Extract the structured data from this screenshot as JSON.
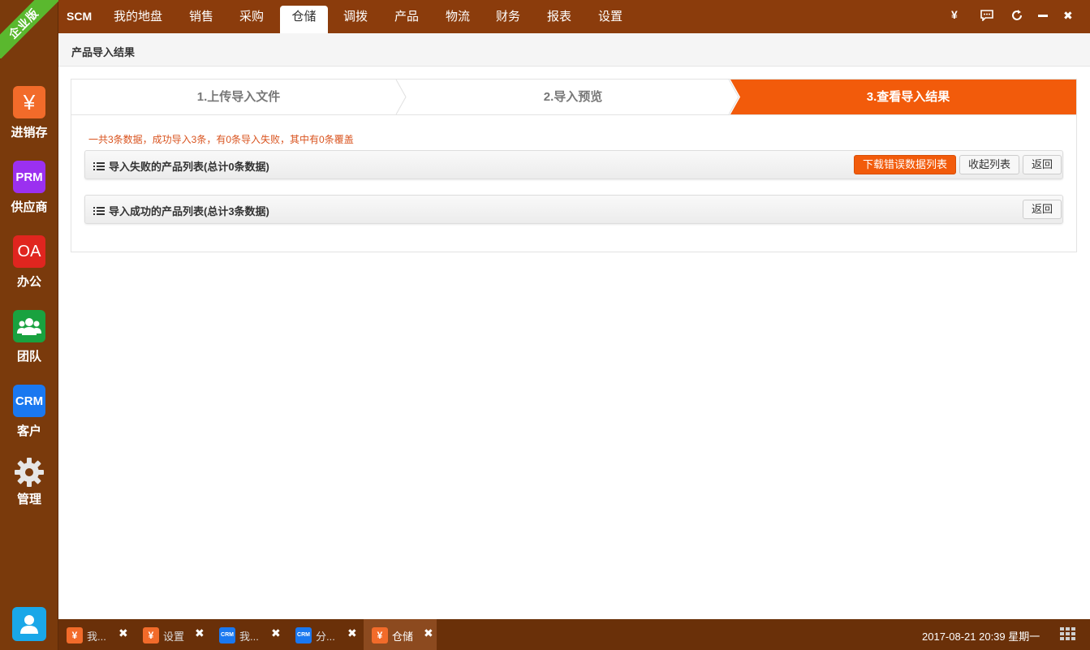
{
  "edition_badge": "企业版",
  "sidebar": {
    "items": [
      {
        "icon_text": "¥",
        "label": "进销存",
        "color": "#f26b2a"
      },
      {
        "icon_text": "PRM",
        "label": "供应商",
        "color": "#9b30f0"
      },
      {
        "icon_text": "OA",
        "label": "办公",
        "color": "#e0251f"
      },
      {
        "icon_text": "",
        "label": "团队",
        "color": "#19a23f"
      },
      {
        "icon_text": "CRM",
        "label": "客户",
        "color": "#1a78f0"
      },
      {
        "icon_text": "",
        "label": "管理",
        "color": "#dddddd"
      }
    ],
    "user_icon_color": "#1aa7e8"
  },
  "topbar": {
    "brand": "SCM",
    "tabs": [
      "我的地盘",
      "销售",
      "采购",
      "仓储",
      "调拨",
      "产品",
      "物流",
      "财务",
      "报表",
      "设置"
    ],
    "active_tab": "仓储",
    "controls": {
      "yen": "¥",
      "chat": "💬",
      "refresh": "↻",
      "minimize": "—",
      "close": "✖"
    }
  },
  "breadcrumb": {
    "title": "产品导入结果"
  },
  "steps": [
    {
      "label": "1.上传导入文件"
    },
    {
      "label": "2.导入预览"
    },
    {
      "label": "3.查看导入结果"
    }
  ],
  "summary": "一共3条数据，成功导入3条，有0条导入失败，其中有0条覆盖",
  "failed_panel": {
    "title": "导入失败的产品列表(总计0条数据)",
    "download_label": "下载错误数据列表",
    "collapse_label": "收起列表",
    "back_label": "返回"
  },
  "success_panel": {
    "title": "导入成功的产品列表(总计3条数据)",
    "back_label": "返回"
  },
  "taskbar": {
    "tasks": [
      {
        "icon_text": "¥",
        "label": "我...",
        "color": "#f26b2a"
      },
      {
        "icon_text": "¥",
        "label": "设置",
        "color": "#f26b2a"
      },
      {
        "icon_text": "CRM",
        "label": "我...",
        "color": "#1a78f0"
      },
      {
        "icon_text": "CRM",
        "label": "分...",
        "color": "#1a78f0"
      },
      {
        "icon_text": "¥",
        "label": "仓储",
        "color": "#f26b2a"
      }
    ],
    "close_glyph": "✖",
    "clock": "2017-08-21 20:39 星期一"
  },
  "colors": {
    "accent": "#f25b0b",
    "sidebar_bg": "#7a3a0c",
    "topbar_bg": "#8b3c0c"
  }
}
